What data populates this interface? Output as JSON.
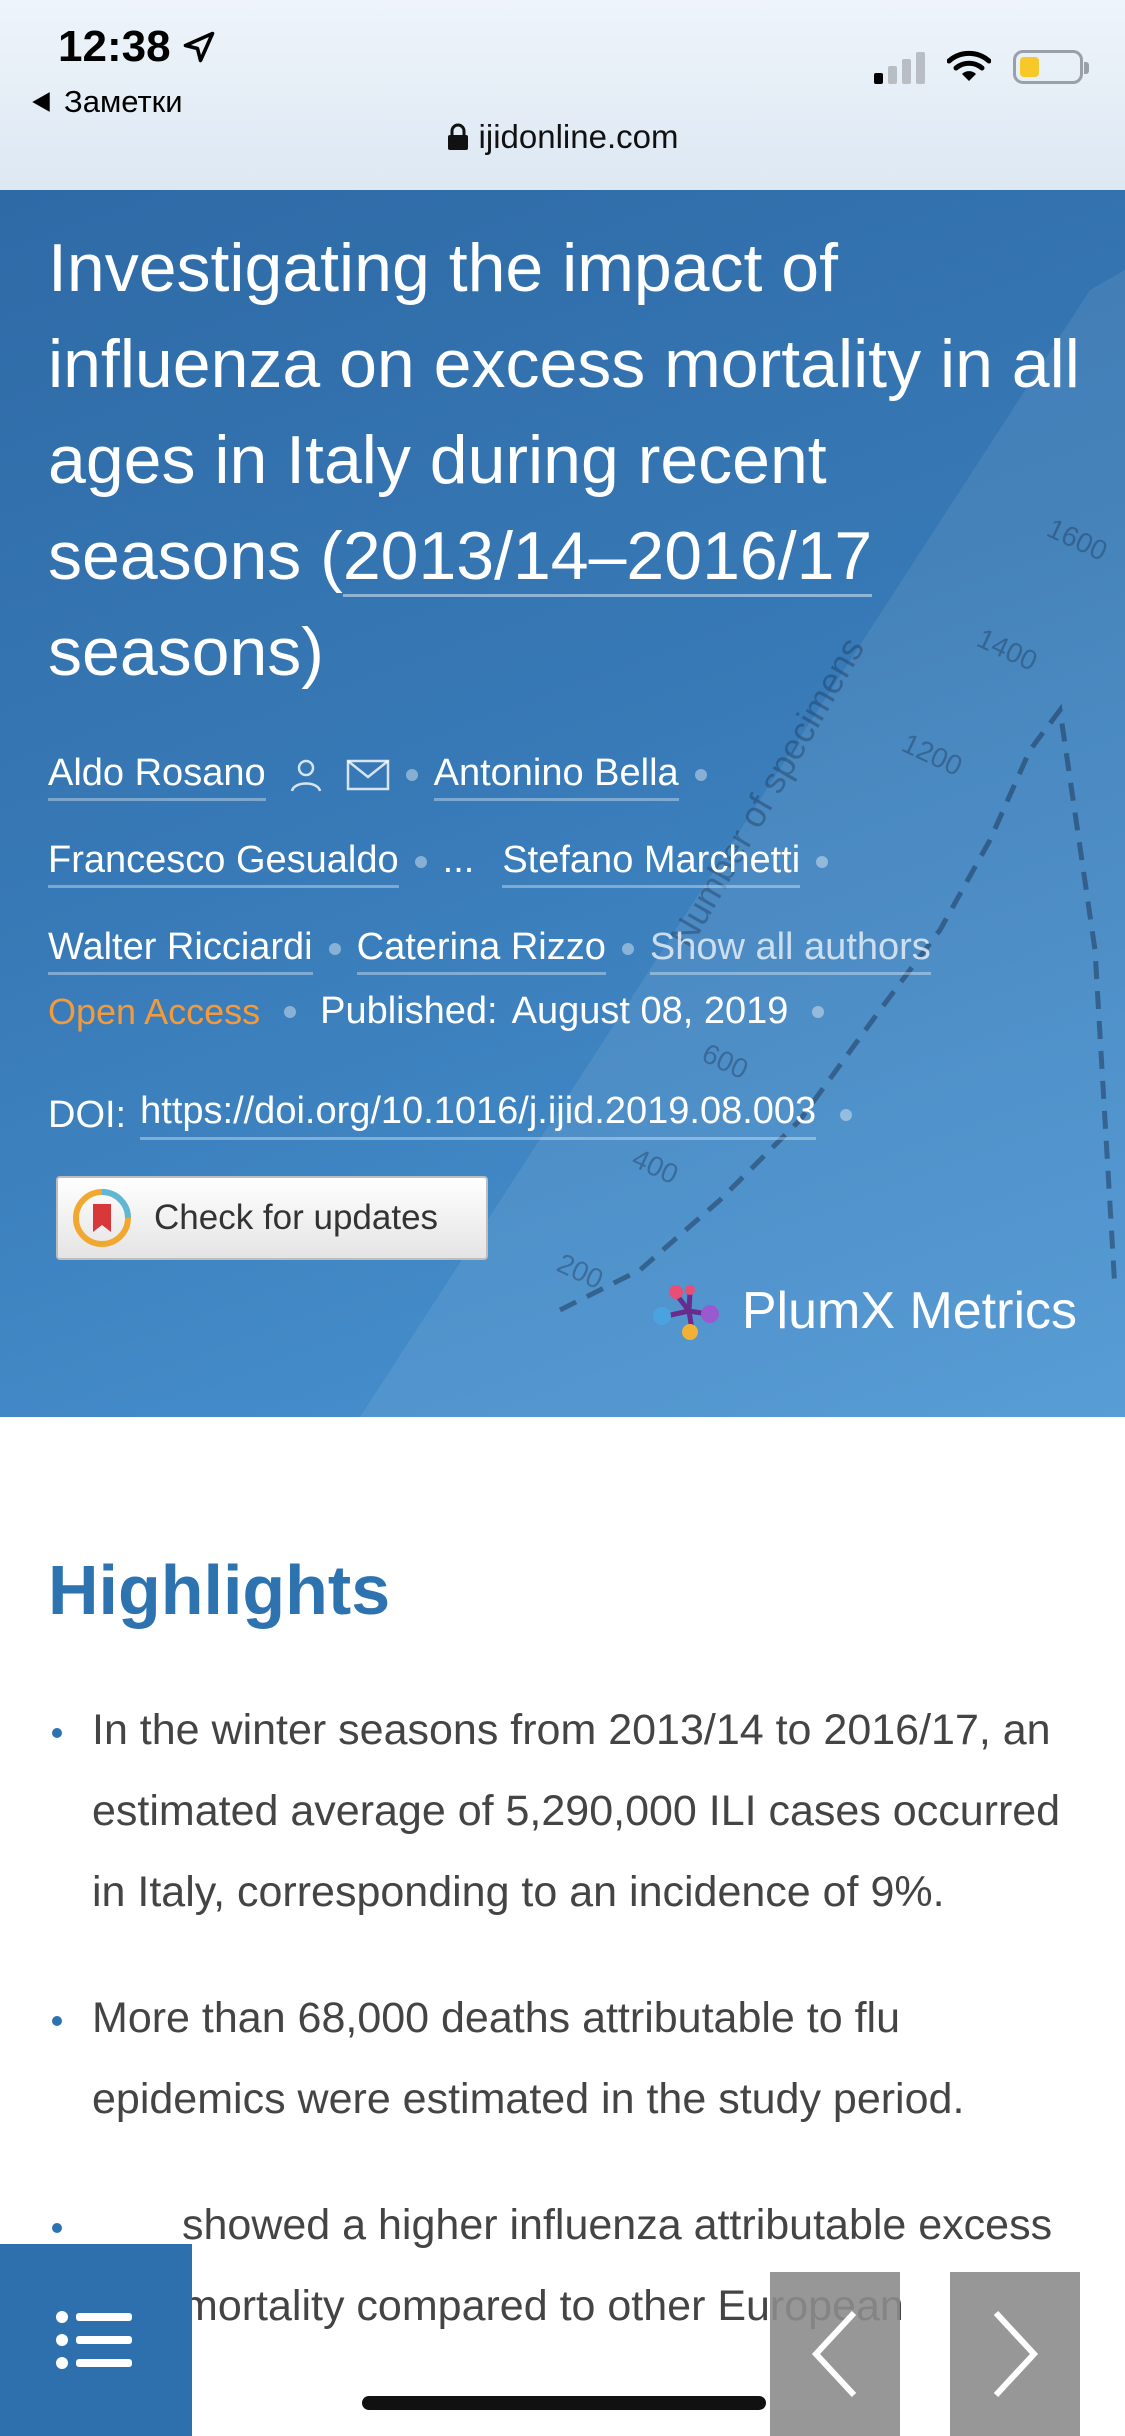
{
  "status": {
    "time": "12:38",
    "back_app": "Заметки",
    "battery_level": 0.3
  },
  "browser": {
    "url": "ijidonline.com"
  },
  "article": {
    "title_part1": "Investigating the impact of influenza on excess mortality in all ages in Italy during recent seasons (",
    "title_link": "2013/14–2016/17",
    "title_part2": " seasons)",
    "authors": [
      "Aldo Rosano",
      "Antonino Bella",
      "Francesco Gesualdo",
      "Stefano Marchetti",
      "Walter Ricciardi",
      "Caterina Rizzo"
    ],
    "authors_ellipsis": "...",
    "show_all_authors": "Show all authors",
    "open_access": "Open Access",
    "published_label": "Published:",
    "published_date": "August 08, 2019",
    "doi_label": "DOI:",
    "doi_link": "https://doi.org/10.1016/j.ijid.2019.08.003",
    "check_updates": "Check for updates",
    "plumx": "PlumX Metrics"
  },
  "hero_chart": {
    "ylabel": "Number of specimens",
    "ticks": [
      "1600",
      "1400",
      "1200",
      "600",
      "400",
      "200"
    ]
  },
  "highlights": {
    "title": "Highlights",
    "items": [
      "In the winter seasons from 2013/14 to 2016/17, an estimated average of 5,290,000 ILI cases occurred in Italy, corresponding to an incidence of 9%.",
      "More than 68,000 deaths attributable to flu epidemics were estimated in the study period.",
      "showed a higher influenza attributable excess mortality compared to other European"
    ]
  },
  "colors": {
    "hero": "#3779b6",
    "accent": "#2d73b0",
    "open_access": "#f39a3c"
  },
  "icons": {
    "toc": "list-icon",
    "prev": "chevron-left-icon",
    "next": "chevron-right-icon"
  }
}
